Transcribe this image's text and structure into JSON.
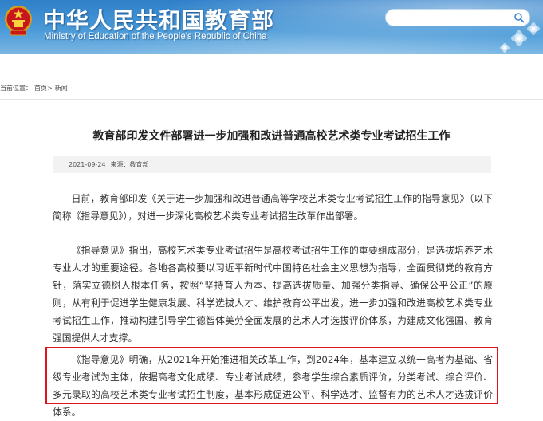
{
  "header": {
    "title": "中华人民共和国教育部",
    "subtitle": "Ministry of Education of the People's Republic of China",
    "search_placeholder": "",
    "colors": {
      "primary": "#2f7fc9",
      "highlight_border": "#e0141e"
    }
  },
  "breadcrumb": {
    "prefix": "当前位置：",
    "items": [
      "首页",
      "新闻"
    ],
    "separator": ">"
  },
  "article": {
    "title": "教育部印发文件部署进一步加强和改进普通高校艺术类专业考试招生工作",
    "date": "2021-09-24",
    "source_label": "来源：教育部",
    "paragraphs": [
      "日前，教育部印发《关于进一步加强和改进普通高等学校艺术类专业考试招生工作的指导意见》（以下简称《指导意见》），对进一步深化高校艺术类专业考试招生改革作出部署。",
      "《指导意见》指出，高校艺术类专业考试招生是高校考试招生工作的重要组成部分，是选拔培养艺术专业人才的重要途径。各地各高校要以习近平新时代中国特色社会主义思想为指导，全面贯彻党的教育方针，落实立德树人根本任务，按照“坚持育人为本、提高选拔质量、加强分类指导、确保公平公正”的原则，从有利于促进学生健康发展、科学选拔人才、维护教育公平出发，进一步加强和改进高校艺术类专业考试招生工作，推动构建引导学生德智体美劳全面发展的艺术人才选拔评价体系，为建成文化强国、教育强国提供人才支撑。",
      "《指导意见》明确，从2021年开始推进相关改革工作，到2024年，基本建立以统一高考为基础、省级专业考试为主体，依据高考文化成绩、专业考试成绩，参考学生综合素质评价，分类考试、综合评价、多元录取的高校艺术类专业考试招生制度，基本形成促进公平、科学选才、监督有力的艺术人才选拔评价体系。"
    ]
  }
}
